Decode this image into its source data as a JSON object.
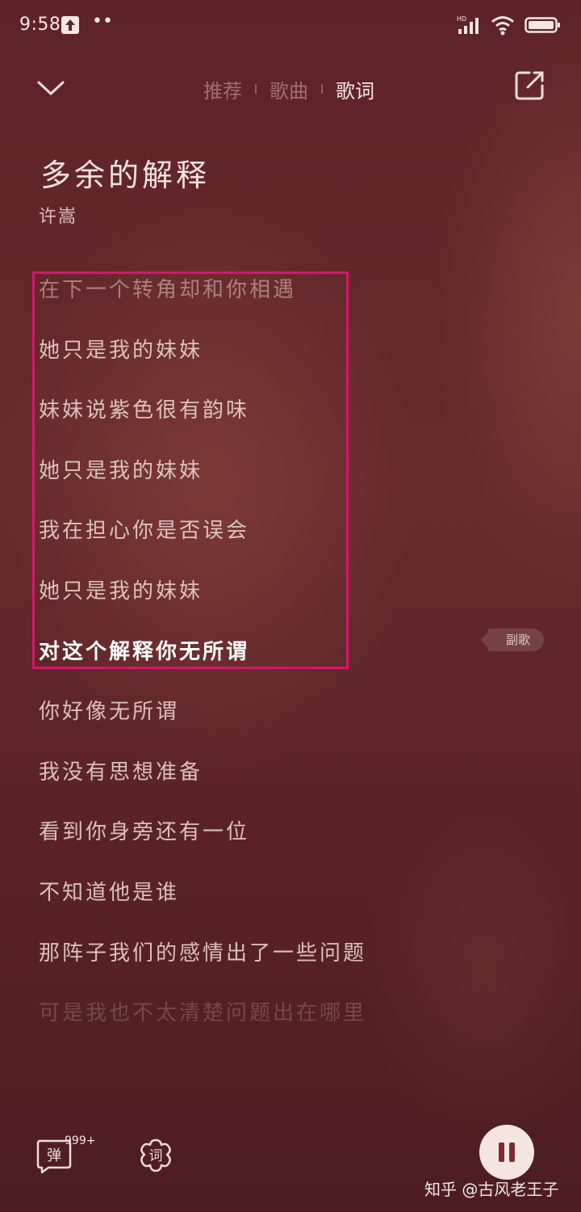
{
  "status_bar": {
    "time": "9:58",
    "dots": "••",
    "hd_label": "HD"
  },
  "nav": {
    "tabs": [
      {
        "label": "推荐"
      },
      {
        "label": "歌曲"
      },
      {
        "label": "歌词"
      }
    ]
  },
  "song": {
    "title": "多余的解释",
    "artist": "许嵩"
  },
  "lyrics": [
    "在下一个转角却和你相遇",
    "她只是我的妹妹",
    "妹妹说紫色很有韵味",
    "她只是我的妹妹",
    "我在担心你是否误会",
    "她只是我的妹妹",
    "对这个解释你无所谓",
    "你好像无所谓",
    "我没有思想准备",
    "看到你身旁还有一位",
    "不知道他是谁",
    "那阵子我们的感情出了一些问题",
    "可是我也不太清楚问题出在哪里"
  ],
  "section_tag": "副歌",
  "controls": {
    "danmaku_label": "弹",
    "danmaku_count": "999+",
    "lyric_label": "词"
  },
  "watermark": "知乎 @古风老王子",
  "colors": {
    "highlight_box": "#d6166c",
    "background": "#5e2327",
    "pause_button": "#f4e4e2"
  }
}
